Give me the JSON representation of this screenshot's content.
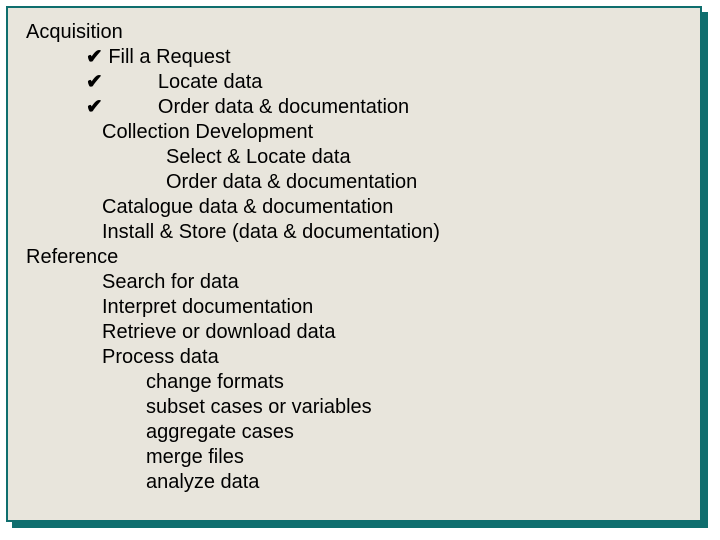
{
  "lines": {
    "acquisition": "Acquisition",
    "fill_request": "Fill a Request",
    "locate_data": "Locate data",
    "order_data": "Order data & documentation",
    "collection_dev": "Collection Development",
    "select_locate": "Select & Locate data",
    "order_data2": "Order data & documentation",
    "catalogue": "Catalogue data & documentation",
    "install_store": "Install & Store (data & documentation)",
    "reference": "Reference",
    "search": "Search for data",
    "interpret": "Interpret documentation",
    "retrieve": "Retrieve or download data",
    "process": "Process data",
    "change_formats": "change formats",
    "subset": "subset cases or variables",
    "aggregate": "aggregate cases",
    "merge": "merge files",
    "analyze": "analyze data"
  },
  "check": "✔"
}
